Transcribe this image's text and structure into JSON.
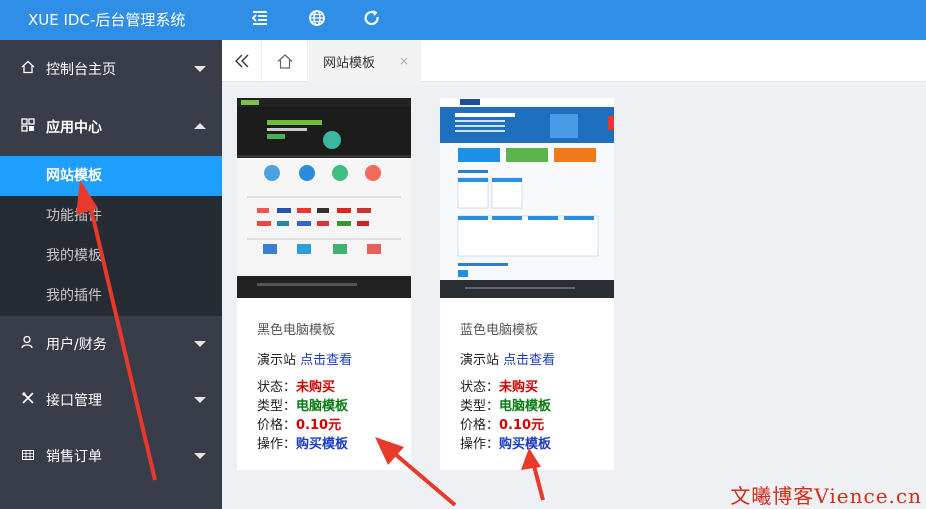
{
  "app": {
    "title": "XUE IDC-后台管理系统"
  },
  "header": {
    "icons": [
      "menu-fold-icon",
      "globe-icon",
      "refresh-icon"
    ]
  },
  "sidebar": {
    "groups": [
      {
        "label": "控制台主页",
        "icon": "home-icon",
        "expanded": false
      },
      {
        "label": "应用中心",
        "icon": "apps-icon",
        "expanded": true,
        "items": [
          {
            "label": "网站模板",
            "active": true
          },
          {
            "label": "功能插件"
          },
          {
            "label": "我的模板"
          },
          {
            "label": "我的插件"
          }
        ]
      },
      {
        "label": "用户/财务",
        "icon": "user-icon",
        "expanded": false
      },
      {
        "label": "接口管理",
        "icon": "tools-icon",
        "expanded": false
      },
      {
        "label": "销售订单",
        "icon": "grid-icon",
        "expanded": false
      }
    ]
  },
  "tabbar": {
    "active_tab": "网站模板",
    "close_glyph": "×"
  },
  "labels": {
    "demo": "演示站",
    "demo_link": "点击查看",
    "status": "状态：",
    "type": "类型：",
    "price": "价格：",
    "action": "操作："
  },
  "templates": [
    {
      "name": "黑色电脑模板",
      "status": "未购买",
      "type": "电脑模板",
      "price": "0.10元",
      "action": "购买模板",
      "theme": "dark"
    },
    {
      "name": "蓝色电脑模板",
      "status": "未购买",
      "type": "电脑模板",
      "price": "0.10元",
      "action": "购买模板",
      "theme": "blue"
    }
  ],
  "watermark": "文曦博客Vience.cn",
  "colors": {
    "header": "#2f8fe6",
    "sidebar": "#393d49",
    "active": "#1e9fff",
    "annotation": "#e8392a"
  }
}
